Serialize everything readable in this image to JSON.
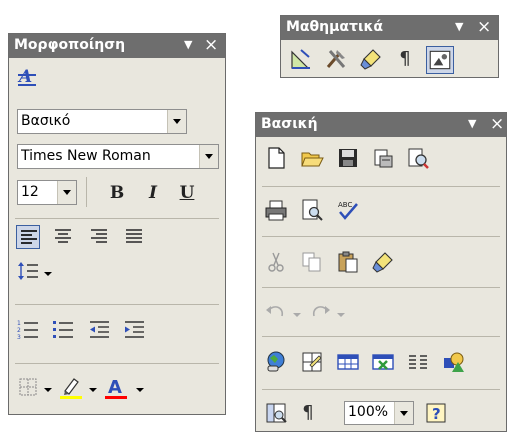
{
  "formatting": {
    "title": "Μορφοποίηση",
    "style_value": "Βασικό",
    "font_value": "Times New Roman",
    "size_value": "12",
    "bold_label": "B",
    "italic_label": "I",
    "underline_label": "U",
    "highlight_color": "#ffff00",
    "font_color": "#ff0000"
  },
  "math": {
    "title": "Μαθηματικά",
    "pilcrow": "¶"
  },
  "standard": {
    "title": "Βασική",
    "pilcrow": "¶",
    "zoom_value": "100%"
  },
  "icons": {
    "title_menu": "chevron-down-icon",
    "title_close": "close-icon"
  }
}
